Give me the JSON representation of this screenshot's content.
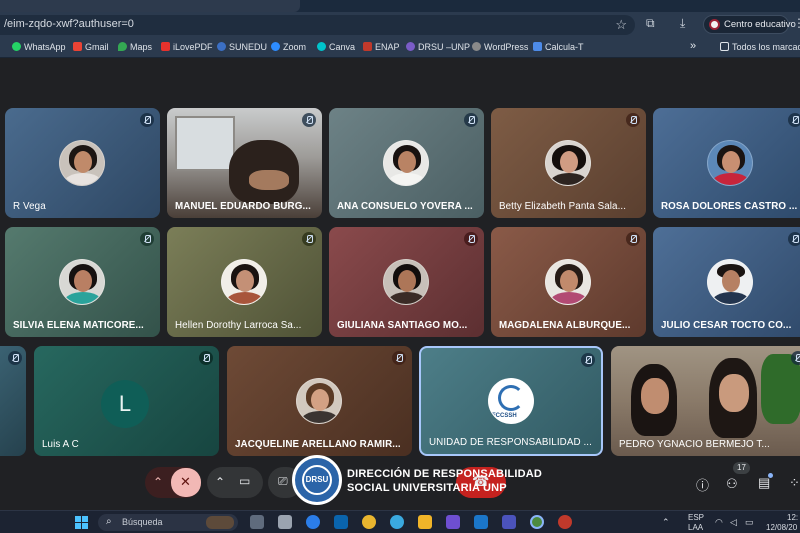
{
  "browser": {
    "url": "/eim-zqdo-xwf?authuser=0",
    "profile_label": "Centro educativo",
    "bookmarks": [
      {
        "label": "WhatsApp",
        "color": "#25d366"
      },
      {
        "label": "Gmail",
        "color": "#ea4335"
      },
      {
        "label": "Maps",
        "color": "#34a853"
      },
      {
        "label": "iLovePDF",
        "color": "#e5322d"
      },
      {
        "label": "SUNEDU",
        "color": "#3b6fc4"
      },
      {
        "label": "Zoom",
        "color": "#2d8cff"
      },
      {
        "label": "Canva",
        "color": "#00c4cc"
      },
      {
        "label": "ENAP",
        "color": "#c0392b"
      },
      {
        "label": "DRSU –UNP",
        "color": "#7a5cc7"
      },
      {
        "label": "WordPress",
        "color": "#8a8a8a"
      },
      {
        "label": "Calcula-T",
        "color": "#4d8be8"
      }
    ],
    "overflow_glyph": "»",
    "all_bookmarks_label": "Todos los marcado"
  },
  "meeting": {
    "participants": [
      {
        "name": "R Vega",
        "bg": "#3d5a78"
      },
      {
        "name": "MANUEL EDUARDO BURG...",
        "bg": "#4f4c4a"
      },
      {
        "name": "ANA CONSUELO YOVERA ...",
        "bg": "#5b6f73"
      },
      {
        "name": "Betty Elizabeth Panta Sala...",
        "bg": "#6b4f3a"
      },
      {
        "name": "ROSA DOLORES CASTRO ...",
        "bg": "#3d5878"
      },
      {
        "name": "SILVIA ELENA MATICORE...",
        "bg": "#3f5a52"
      },
      {
        "name": "Hellen Dorothy Larroca Sa...",
        "bg": "#5f6244"
      },
      {
        "name": "GIULIANA SANTIAGO MO...",
        "bg": "#6e3f3f"
      },
      {
        "name": "MAGDALENA ALBURQUE...",
        "bg": "#6a4637"
      },
      {
        "name": "JULIO CESAR TOCTO CO...",
        "bg": "#3c5b7e"
      },
      {
        "name": "Luis A C",
        "bg": "#1d5a55",
        "letter": "L"
      },
      {
        "name": "JACQUELINE ARELLANO RAMIR...",
        "bg": "#5c3d2c"
      },
      {
        "name": "UNIDAD DE RESPONSABILIDAD ...",
        "bg": "#3d6c76",
        "logo_text": "FCCSSH"
      },
      {
        "name": "PEDRO YGNACIO BERMEJO T...",
        "bg": "#6d5f52"
      }
    ],
    "participant_count": "17"
  },
  "watermark": {
    "seal_text": "DRSU",
    "line1": "DIRECCIÓN DE RESPONSABILIDAD",
    "line2": "SOCIAL UNIVERSITARIA UNP"
  },
  "taskbar": {
    "search_placeholder": "Búsqueda",
    "lang_top": "ESP",
    "lang_bottom": "LAA",
    "time": "12:",
    "date": "12/08/20"
  }
}
